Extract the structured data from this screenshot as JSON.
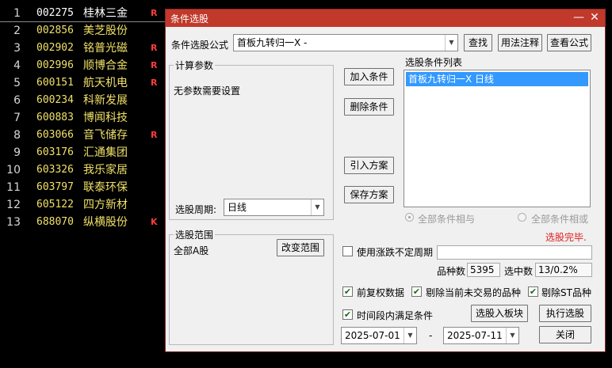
{
  "stocks": [
    {
      "idx": "1",
      "code": "002275",
      "name": "桂林三金",
      "flag": "R",
      "selected": true
    },
    {
      "idx": "2",
      "code": "002856",
      "name": "美芝股份",
      "flag": ""
    },
    {
      "idx": "3",
      "code": "002902",
      "name": "铭普光磁",
      "flag": "R"
    },
    {
      "idx": "4",
      "code": "002996",
      "name": "顺博合金",
      "flag": "R"
    },
    {
      "idx": "5",
      "code": "600151",
      "name": "航天机电",
      "flag": "R"
    },
    {
      "idx": "6",
      "code": "600234",
      "name": "科新发展",
      "flag": ""
    },
    {
      "idx": "7",
      "code": "600883",
      "name": "博闻科技",
      "flag": ""
    },
    {
      "idx": "8",
      "code": "603066",
      "name": "音飞储存",
      "flag": "R"
    },
    {
      "idx": "9",
      "code": "603176",
      "name": "汇通集团",
      "flag": ""
    },
    {
      "idx": "10",
      "code": "603326",
      "name": "我乐家居",
      "flag": ""
    },
    {
      "idx": "11",
      "code": "603797",
      "name": "联泰环保",
      "flag": ""
    },
    {
      "idx": "12",
      "code": "605122",
      "name": "四方新材",
      "flag": ""
    },
    {
      "idx": "13",
      "code": "688070",
      "name": "纵横股份",
      "flag": "K"
    }
  ],
  "dialog": {
    "title": "条件选股",
    "minimize_glyph": "—",
    "close_glyph": "✕",
    "formula_label": "条件选股公式",
    "formula_value": "首板九转归一X -",
    "find_button": "查找",
    "usage_button": "用法注释",
    "view_formula_button": "查看公式",
    "params_group_title": "计算参数",
    "params_text": "无参数需要设置",
    "period_label": "选股周期:",
    "period_value": "日线",
    "add_condition_button": "加入条件",
    "delete_condition_button": "删除条件",
    "import_plan_button": "引入方案",
    "save_plan_button": "保存方案",
    "condition_list_label": "选股条件列表",
    "condition_items": [
      "首板九转归一X  日线"
    ],
    "radio_and": "全部条件相与",
    "radio_or": "全部条件相或",
    "status_text": "选股完毕.",
    "range_group_title": "选股范围",
    "range_value": "全部A股",
    "change_range_button": "改变范围",
    "variable_period_label": "使用涨跌不定周期",
    "variable_period_value": "",
    "count_label": "品种数",
    "count_value": "5395",
    "selected_label": "选中数",
    "selected_value": "13/0.2%",
    "forward_adjust_label": "前复权数据",
    "exclude_untraded_label": "剔除当前未交易的品种",
    "exclude_st_label": "剔除ST品种",
    "time_period_label": "时间段内满足条件",
    "add_to_board_button": "选股入板块",
    "execute_button": "执行选股",
    "date_from": "2025-07-01",
    "date_sep": "-",
    "date_to": "2025-07-11",
    "close_button": "关闭",
    "check_glyph": "✔"
  },
  "colors": {
    "title_bar": "#c0392b",
    "stock_code": "#f0e068",
    "flag_red": "#ff3c3c",
    "selection": "#3399ff",
    "status_red": "#e02020"
  }
}
